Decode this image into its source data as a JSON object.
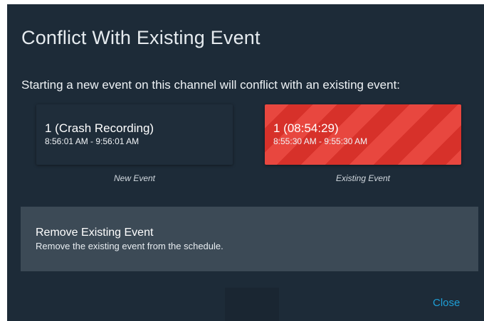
{
  "dialog": {
    "title": "Conflict With Existing Event",
    "message": "Starting a new event on this channel will conflict with an existing event:",
    "new_event": {
      "title": "1 (Crash Recording)",
      "time_range": "8:56:01 AM - 9:56:01 AM",
      "caption": "New Event"
    },
    "existing_event": {
      "title": "1 (08:54:29)",
      "time_range": "8:55:30 AM - 9:55:30 AM",
      "caption": "Existing Event"
    },
    "option": {
      "title": "Remove Existing Event",
      "description": "Remove the existing event from the schedule."
    },
    "close_label": "Close"
  },
  "colors": {
    "background": "#1d2b38",
    "existing_event_red": "#e8473f",
    "option_panel": "#3c4a56",
    "link_blue": "#1e9fd6"
  }
}
